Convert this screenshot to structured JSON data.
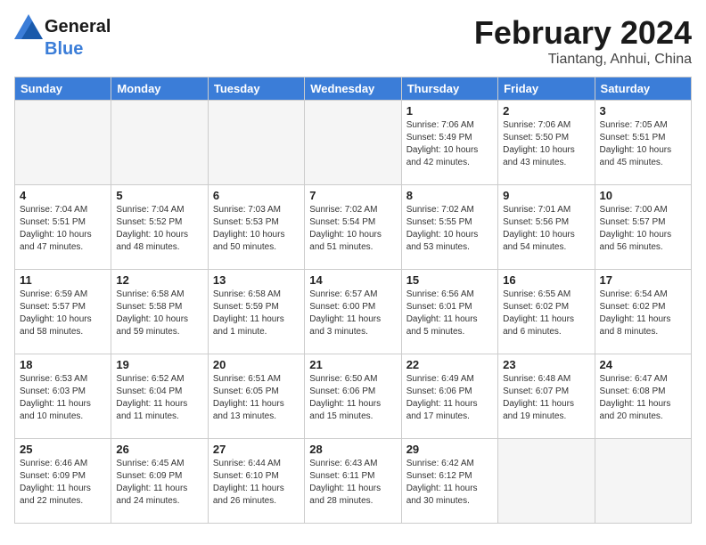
{
  "logo": {
    "line1": "General",
    "line2": "Blue"
  },
  "title": "February 2024",
  "subtitle": "Tiantang, Anhui, China",
  "weekdays": [
    "Sunday",
    "Monday",
    "Tuesday",
    "Wednesday",
    "Thursday",
    "Friday",
    "Saturday"
  ],
  "weeks": [
    [
      {
        "day": "",
        "empty": true
      },
      {
        "day": "",
        "empty": true
      },
      {
        "day": "",
        "empty": true
      },
      {
        "day": "",
        "empty": true
      },
      {
        "day": "1",
        "info": "Sunrise: 7:06 AM\nSunset: 5:49 PM\nDaylight: 10 hours\nand 42 minutes."
      },
      {
        "day": "2",
        "info": "Sunrise: 7:06 AM\nSunset: 5:50 PM\nDaylight: 10 hours\nand 43 minutes."
      },
      {
        "day": "3",
        "info": "Sunrise: 7:05 AM\nSunset: 5:51 PM\nDaylight: 10 hours\nand 45 minutes."
      }
    ],
    [
      {
        "day": "4",
        "info": "Sunrise: 7:04 AM\nSunset: 5:51 PM\nDaylight: 10 hours\nand 47 minutes."
      },
      {
        "day": "5",
        "info": "Sunrise: 7:04 AM\nSunset: 5:52 PM\nDaylight: 10 hours\nand 48 minutes."
      },
      {
        "day": "6",
        "info": "Sunrise: 7:03 AM\nSunset: 5:53 PM\nDaylight: 10 hours\nand 50 minutes."
      },
      {
        "day": "7",
        "info": "Sunrise: 7:02 AM\nSunset: 5:54 PM\nDaylight: 10 hours\nand 51 minutes."
      },
      {
        "day": "8",
        "info": "Sunrise: 7:02 AM\nSunset: 5:55 PM\nDaylight: 10 hours\nand 53 minutes."
      },
      {
        "day": "9",
        "info": "Sunrise: 7:01 AM\nSunset: 5:56 PM\nDaylight: 10 hours\nand 54 minutes."
      },
      {
        "day": "10",
        "info": "Sunrise: 7:00 AM\nSunset: 5:57 PM\nDaylight: 10 hours\nand 56 minutes."
      }
    ],
    [
      {
        "day": "11",
        "info": "Sunrise: 6:59 AM\nSunset: 5:57 PM\nDaylight: 10 hours\nand 58 minutes."
      },
      {
        "day": "12",
        "info": "Sunrise: 6:58 AM\nSunset: 5:58 PM\nDaylight: 10 hours\nand 59 minutes."
      },
      {
        "day": "13",
        "info": "Sunrise: 6:58 AM\nSunset: 5:59 PM\nDaylight: 11 hours\nand 1 minute."
      },
      {
        "day": "14",
        "info": "Sunrise: 6:57 AM\nSunset: 6:00 PM\nDaylight: 11 hours\nand 3 minutes."
      },
      {
        "day": "15",
        "info": "Sunrise: 6:56 AM\nSunset: 6:01 PM\nDaylight: 11 hours\nand 5 minutes."
      },
      {
        "day": "16",
        "info": "Sunrise: 6:55 AM\nSunset: 6:02 PM\nDaylight: 11 hours\nand 6 minutes."
      },
      {
        "day": "17",
        "info": "Sunrise: 6:54 AM\nSunset: 6:02 PM\nDaylight: 11 hours\nand 8 minutes."
      }
    ],
    [
      {
        "day": "18",
        "info": "Sunrise: 6:53 AM\nSunset: 6:03 PM\nDaylight: 11 hours\nand 10 minutes."
      },
      {
        "day": "19",
        "info": "Sunrise: 6:52 AM\nSunset: 6:04 PM\nDaylight: 11 hours\nand 11 minutes."
      },
      {
        "day": "20",
        "info": "Sunrise: 6:51 AM\nSunset: 6:05 PM\nDaylight: 11 hours\nand 13 minutes."
      },
      {
        "day": "21",
        "info": "Sunrise: 6:50 AM\nSunset: 6:06 PM\nDaylight: 11 hours\nand 15 minutes."
      },
      {
        "day": "22",
        "info": "Sunrise: 6:49 AM\nSunset: 6:06 PM\nDaylight: 11 hours\nand 17 minutes."
      },
      {
        "day": "23",
        "info": "Sunrise: 6:48 AM\nSunset: 6:07 PM\nDaylight: 11 hours\nand 19 minutes."
      },
      {
        "day": "24",
        "info": "Sunrise: 6:47 AM\nSunset: 6:08 PM\nDaylight: 11 hours\nand 20 minutes."
      }
    ],
    [
      {
        "day": "25",
        "info": "Sunrise: 6:46 AM\nSunset: 6:09 PM\nDaylight: 11 hours\nand 22 minutes."
      },
      {
        "day": "26",
        "info": "Sunrise: 6:45 AM\nSunset: 6:09 PM\nDaylight: 11 hours\nand 24 minutes."
      },
      {
        "day": "27",
        "info": "Sunrise: 6:44 AM\nSunset: 6:10 PM\nDaylight: 11 hours\nand 26 minutes."
      },
      {
        "day": "28",
        "info": "Sunrise: 6:43 AM\nSunset: 6:11 PM\nDaylight: 11 hours\nand 28 minutes."
      },
      {
        "day": "29",
        "info": "Sunrise: 6:42 AM\nSunset: 6:12 PM\nDaylight: 11 hours\nand 30 minutes."
      },
      {
        "day": "",
        "empty": true
      },
      {
        "day": "",
        "empty": true
      }
    ]
  ]
}
